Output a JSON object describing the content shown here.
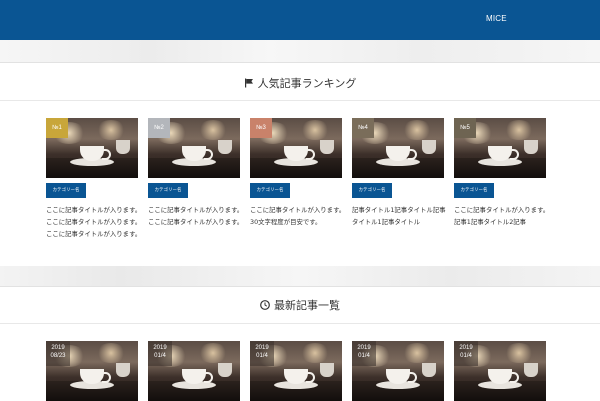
{
  "header": {
    "nav_items": [
      "MICE"
    ],
    "accent": "#0a5593"
  },
  "sections": {
    "ranking": {
      "title": "人気記事ランキング",
      "icon": "flag-icon",
      "cards": [
        {
          "rank": "№1",
          "rank_color": "#c8a63a",
          "category": "カテゴリー名",
          "title": "ここに記事タイトルが入ります。ここに記事タイトルが入ります。ここに記事タイトルが入ります。"
        },
        {
          "rank": "№2",
          "rank_color": "#b3b6bb",
          "category": "カテゴリー名",
          "title": "ここに記事タイトルが入ります。ここに記事タイトルが入ります。"
        },
        {
          "rank": "№3",
          "rank_color": "#c9826a",
          "category": "カテゴリー名",
          "title": "ここに記事タイトルが入ります。30文字程度が目安です。"
        },
        {
          "rank": "№4",
          "rank_color": "#7a6d5a",
          "category": "カテゴリー名",
          "title": "記事タイトル1記事タイトル記事タイトル1記事タイトル"
        },
        {
          "rank": "№5",
          "rank_color": "#6e6452",
          "category": "カテゴリー名",
          "title": "ここに記事タイトルが入ります。記事1記事タイトル2記事"
        }
      ]
    },
    "latest": {
      "title": "最新記事一覧",
      "icon": "clock-icon",
      "cards": [
        {
          "year": "2019",
          "date": "08/23"
        },
        {
          "year": "2019",
          "date": "01/4"
        },
        {
          "year": "2019",
          "date": "01/4"
        },
        {
          "year": "2019",
          "date": "01/4"
        },
        {
          "year": "2019",
          "date": "01/4"
        }
      ]
    }
  }
}
